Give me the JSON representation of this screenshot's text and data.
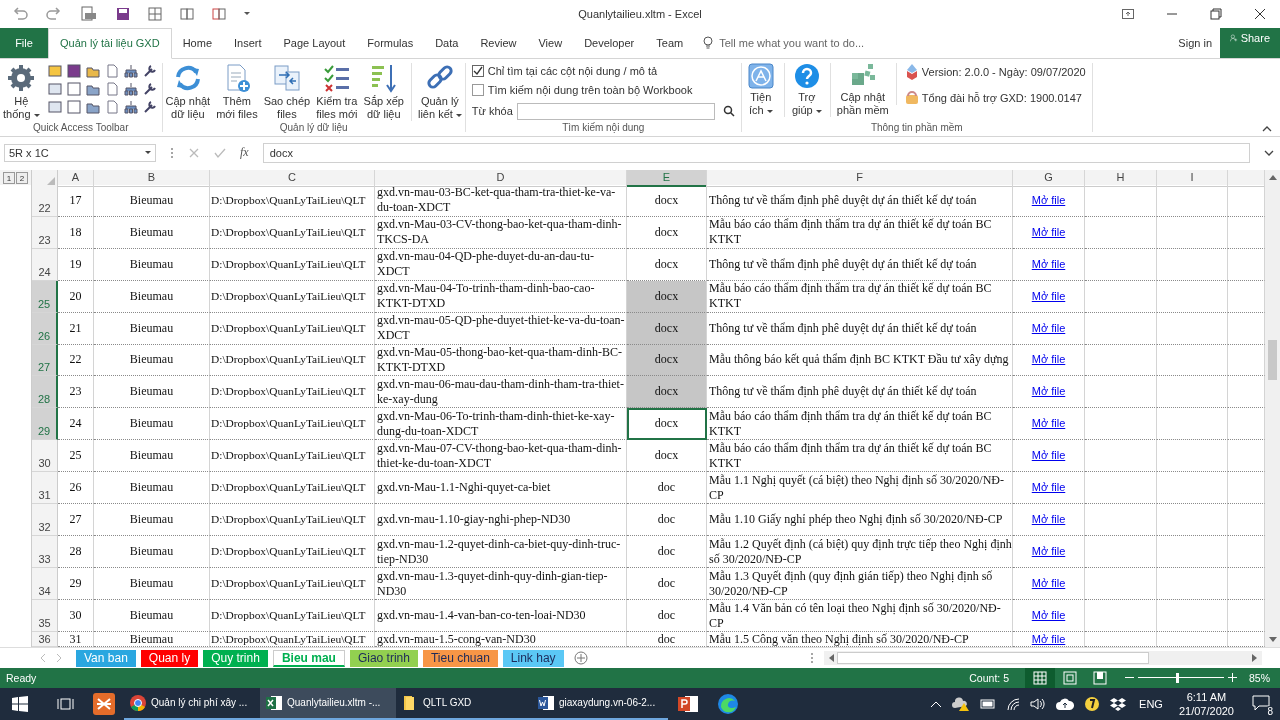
{
  "window": {
    "title": "Quanlytailieu.xltm - Excel"
  },
  "menu_tabs": [
    {
      "label": "File",
      "kind": "file",
      "selected": false
    },
    {
      "label": "Quản lý tài liệu GXD",
      "kind": "tab",
      "selected": true
    },
    {
      "label": "Home",
      "kind": "tab",
      "selected": false
    },
    {
      "label": "Insert",
      "kind": "tab",
      "selected": false
    },
    {
      "label": "Page Layout",
      "kind": "tab",
      "selected": false
    },
    {
      "label": "Formulas",
      "kind": "tab",
      "selected": false
    },
    {
      "label": "Data",
      "kind": "tab",
      "selected": false
    },
    {
      "label": "Review",
      "kind": "tab",
      "selected": false
    },
    {
      "label": "View",
      "kind": "tab",
      "selected": false
    },
    {
      "label": "Developer",
      "kind": "tab",
      "selected": false
    },
    {
      "label": "Team",
      "kind": "tab",
      "selected": false
    }
  ],
  "tell_me": {
    "placeholder": "Tell me what you want to do..."
  },
  "sign_in": "Sign in",
  "share": "Share",
  "ribbon": {
    "system": {
      "label": "Hệ\nthống",
      "dropdown": true
    },
    "qat_label": "Quick Access Toolbar",
    "data_buttons": [
      {
        "label": "Cập nhật\ndữ liệu",
        "dropdown": false
      },
      {
        "label": "Thêm\nmới files",
        "dropdown": false
      },
      {
        "label": "Sao chép\nfiles",
        "dropdown": false
      },
      {
        "label": "Kiểm tra\nfiles mới",
        "dropdown": false
      },
      {
        "label": "Sắp xếp\ndữ liệu",
        "dropdown": false
      },
      {
        "label": "Quản lý\nliên kết",
        "dropdown": true
      }
    ],
    "data_label": "Quản lý dữ liệu",
    "search": {
      "options": [
        {
          "label": "Chỉ tìm tại các cột nội dung / mô tả",
          "checked": true
        },
        {
          "label": "Tìm kiếm nội dung trên toàn bộ Workbook",
          "checked": false
        }
      ],
      "keyword_label": "Từ khóa",
      "label": "Tìm kiếm nội dung"
    },
    "tools": [
      {
        "label": "Tiện\ních",
        "dropdown": true
      },
      {
        "label": "Trợ\ngiúp",
        "dropdown": true
      },
      {
        "label": "Cập nhật\nphần mềm",
        "dropdown": false
      }
    ],
    "info": {
      "version": "Version: 2.0.0 - Ngày: 09/07/2020",
      "hotline": "Tổng đài hỗ trợ GXD: 1900.0147",
      "label": "Thông tin phần mềm"
    }
  },
  "formula_bar": {
    "name_box": "5R x 1C",
    "function_button": "fx",
    "value": "docx"
  },
  "outline_levels": [
    "1",
    "2"
  ],
  "columns": [
    {
      "label": "A",
      "selected": false
    },
    {
      "label": "B",
      "selected": false
    },
    {
      "label": "C",
      "selected": false
    },
    {
      "label": "D",
      "selected": false
    },
    {
      "label": "E",
      "selected": true
    },
    {
      "label": "F",
      "selected": false
    },
    {
      "label": "G",
      "selected": false
    },
    {
      "label": "H",
      "selected": false
    },
    {
      "label": "I",
      "selected": false
    }
  ],
  "rows": [
    {
      "row": "22",
      "a": "17",
      "b": "Bieumau",
      "c": "D:\\Dropbox\\QuanLyTaiLieu\\QLT",
      "d": "gxd.vn-mau-03-BC-ket-qua-tham-tra-thiet-ke-va-du-toan-XDCT",
      "e": "docx",
      "f": "Thông tư về thẩm định phê duyệt dự án thiết kế dự toán",
      "g": "Mở file",
      "selected": false,
      "active": false
    },
    {
      "row": "23",
      "a": "18",
      "b": "Bieumau",
      "c": "D:\\Dropbox\\QuanLyTaiLieu\\QLT",
      "d": "gxd.vn-Mau-03-CV-thong-bao-ket-qua-tham-dinh-TKCS-DA",
      "e": "docx",
      "f": "Mẫu báo cáo thẩm định thẩm tra dự án thiết kế dự toán BC KTKT",
      "g": "Mở file",
      "selected": false,
      "active": false
    },
    {
      "row": "24",
      "a": "19",
      "b": "Bieumau",
      "c": "D:\\Dropbox\\QuanLyTaiLieu\\QLT",
      "d": "gxd.vn-mau-04-QD-phe-duyet-du-an-dau-tu-XDCT",
      "e": "docx",
      "f": "Thông tư về thẩm định phê duyệt dự án thiết kế dự toán",
      "g": "Mở file",
      "selected": false,
      "active": false
    },
    {
      "row": "25",
      "a": "20",
      "b": "Bieumau",
      "c": "D:\\Dropbox\\QuanLyTaiLieu\\QLT",
      "d": "gxd.vn-Mau-04-To-trinh-tham-dinh-bao-cao-KTKT-DTXD",
      "e": "docx",
      "f": "Mẫu báo cáo thẩm định thẩm tra dự án thiết kế dự toán BC KTKT",
      "g": "Mở file",
      "selected": true,
      "active": false
    },
    {
      "row": "26",
      "a": "21",
      "b": "Bieumau",
      "c": "D:\\Dropbox\\QuanLyTaiLieu\\QLT",
      "d": "gxd.vn-mau-05-QD-phe-duyet-thiet-ke-va-du-toan-XDCT",
      "e": "docx",
      "f": "Thông tư về thẩm định phê duyệt dự án thiết kế dự toán",
      "g": "Mở file",
      "selected": true,
      "active": false
    },
    {
      "row": "27",
      "a": "22",
      "b": "Bieumau",
      "c": "D:\\Dropbox\\QuanLyTaiLieu\\QLT",
      "d": "gxd.vn-Mau-05-thong-bao-ket-qua-tham-dinh-BC-KTKT-DTXD",
      "e": "docx",
      "f": "Mẫu thông báo kết quả thẩm định BC KTKT Đầu tư xây dựng",
      "g": "Mở file",
      "selected": true,
      "active": false
    },
    {
      "row": "28",
      "a": "23",
      "b": "Bieumau",
      "c": "D:\\Dropbox\\QuanLyTaiLieu\\QLT",
      "d": "gxd.vn-mau-06-mau-dau-tham-dinh-tham-tra-thiet-ke-xay-dung",
      "e": "docx",
      "f": "Thông tư về thẩm định phê duyệt dự án thiết kế dự toán",
      "g": "Mở file",
      "selected": true,
      "active": false
    },
    {
      "row": "29",
      "a": "24",
      "b": "Bieumau",
      "c": "D:\\Dropbox\\QuanLyTaiLieu\\QLT",
      "d": "gxd.vn-Mau-06-To-trinh-tham-dinh-thiet-ke-xay-dung-du-toan-XDCT",
      "e": "docx",
      "f": "Mẫu báo cáo thẩm định thẩm tra dự án thiết kế dự toán BC KTKT",
      "g": "Mở file",
      "selected": true,
      "active": true
    },
    {
      "row": "30",
      "a": "25",
      "b": "Bieumau",
      "c": "D:\\Dropbox\\QuanLyTaiLieu\\QLT",
      "d": "gxd.vn-Mau-07-CV-thong-bao-ket-qua-tham-dinh-thiet-ke-du-toan-XDCT",
      "e": "docx",
      "f": "Mẫu báo cáo thẩm định thẩm tra dự án thiết kế dự toán BC KTKT",
      "g": "Mở file",
      "selected": false,
      "active": false
    },
    {
      "row": "31",
      "a": "26",
      "b": "Bieumau",
      "c": "D:\\Dropbox\\QuanLyTaiLieu\\QLT",
      "d": "gxd.vn-Mau-1.1-Nghi-quyet-ca-biet",
      "e": "doc",
      "f": "Mẫu 1.1 Nghị quyết (cá biệt) theo Nghị định số 30/2020/NĐ-CP",
      "g": "Mở file",
      "selected": false,
      "active": false
    },
    {
      "row": "32",
      "a": "27",
      "b": "Bieumau",
      "c": "D:\\Dropbox\\QuanLyTaiLieu\\QLT",
      "d": "gxd.vn-mau-1.10-giay-nghi-phep-ND30",
      "e": "doc",
      "f": "Mẫu 1.10 Giấy nghỉ phép theo Nghị định số 30/2020/NĐ-CP",
      "g": "Mở file",
      "selected": false,
      "active": false
    },
    {
      "row": "33",
      "a": "28",
      "b": "Bieumau",
      "c": "D:\\Dropbox\\QuanLyTaiLieu\\QLT",
      "d": "gxd.vn-mau-1.2-quyet-dinh-ca-biet-quy-dinh-truc-tiep-ND30",
      "e": "doc",
      "f": "Mẫu 1.2 Quyết định (cá biệt) quy định trực tiếp theo Nghị định số 30/2020/NĐ-CP",
      "g": "Mở file",
      "selected": false,
      "active": false
    },
    {
      "row": "34",
      "a": "29",
      "b": "Bieumau",
      "c": "D:\\Dropbox\\QuanLyTaiLieu\\QLT",
      "d": "gxd.vn-mau-1.3-quyet-dinh-quy-dinh-gian-tiep-ND30",
      "e": "doc",
      "f": "Mẫu 1.3 Quyết định (quy định gián tiếp) theo Nghị định số 30/2020/NĐ-CP",
      "g": "Mở file",
      "selected": false,
      "active": false
    },
    {
      "row": "35",
      "a": "30",
      "b": "Bieumau",
      "c": "D:\\Dropbox\\QuanLyTaiLieu\\QLT",
      "d": "gxd.vn-mau-1.4-van-ban-co-ten-loai-ND30",
      "e": "doc",
      "f": "Mẫu 1.4 Văn bản có tên loại theo Nghị định số 30/2020/NĐ-CP",
      "g": "Mở file",
      "selected": false,
      "active": false
    },
    {
      "row": "36",
      "a": "31",
      "b": "Bieumau",
      "c": "D:\\Dropbox\\QuanLyTaiLieu\\QLT",
      "d": "gxd.vn-mau-1.5-cong-van-ND30",
      "e": "doc",
      "f": "Mẫu 1.5 Công văn theo Nghị định số 30/2020/NĐ-CP",
      "g": "Mở file",
      "selected": false,
      "active": false
    }
  ],
  "sheet_tabs": [
    {
      "label": "Van ban",
      "color": "#2aa7e0",
      "selected": false
    },
    {
      "label": "Quan ly",
      "color": "#ff0000",
      "selected": false
    },
    {
      "label": "Quy trinh",
      "color": "#00b050",
      "selected": false
    },
    {
      "label": "Bieu mau",
      "color": "#00b050",
      "selected": true
    },
    {
      "label": "Giao trinh",
      "color": "#92d050",
      "selected": false
    },
    {
      "label": "Tieu chuan",
      "color": "#f79646",
      "selected": false
    },
    {
      "label": "Link hay",
      "color": "#5bc8f5",
      "selected": false
    }
  ],
  "status_bar": {
    "status": "Ready",
    "count": "Count: 5",
    "zoom": {
      "level": 0.45,
      "reading": "85%"
    }
  },
  "taskbar": {
    "apps": [
      {
        "label": "Quản lý chi phí xây ...",
        "kind": "chrome",
        "selected": false
      },
      {
        "label": "Quanlytailieu.xltm -...",
        "kind": "excel",
        "selected": true
      },
      {
        "label": "QLTL GXD",
        "kind": "folder",
        "selected": false
      },
      {
        "label": "giaxaydung.vn-06-2...",
        "kind": "word",
        "selected": false
      }
    ],
    "language": "ENG",
    "time": "6:11 AM",
    "date": "21/07/2020",
    "notifications": "8"
  }
}
